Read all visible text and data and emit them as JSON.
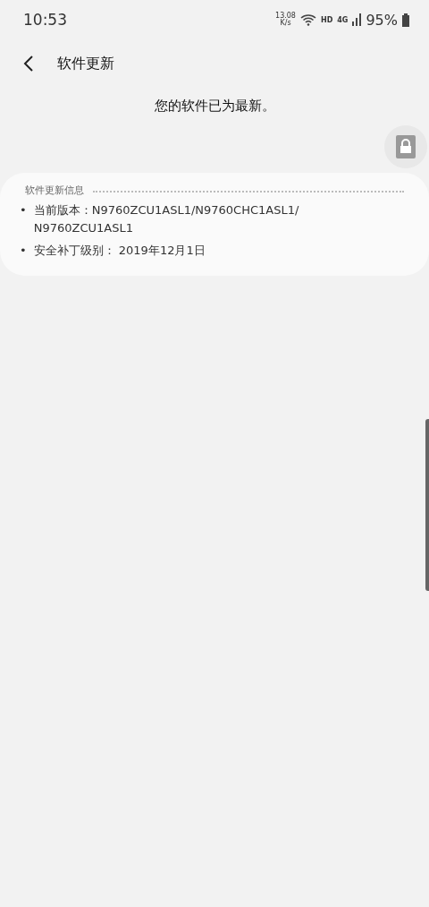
{
  "status_bar": {
    "time": "10:53",
    "net_speed": "13.08",
    "net_unit": "K/s",
    "hd": "HD",
    "network": "4G",
    "battery": "95%"
  },
  "header": {
    "title": "软件更新"
  },
  "message": "您的软件已为最新。",
  "info_card": {
    "title": "软件更新信息",
    "items": [
      {
        "bullet": "•",
        "text": "当前版本：N9760ZCU1ASL1/N9760CHC1ASL1/ N9760ZCU1ASL1"
      },
      {
        "bullet": "•",
        "text": "安全补丁级别： 2019年12月1日"
      }
    ]
  }
}
